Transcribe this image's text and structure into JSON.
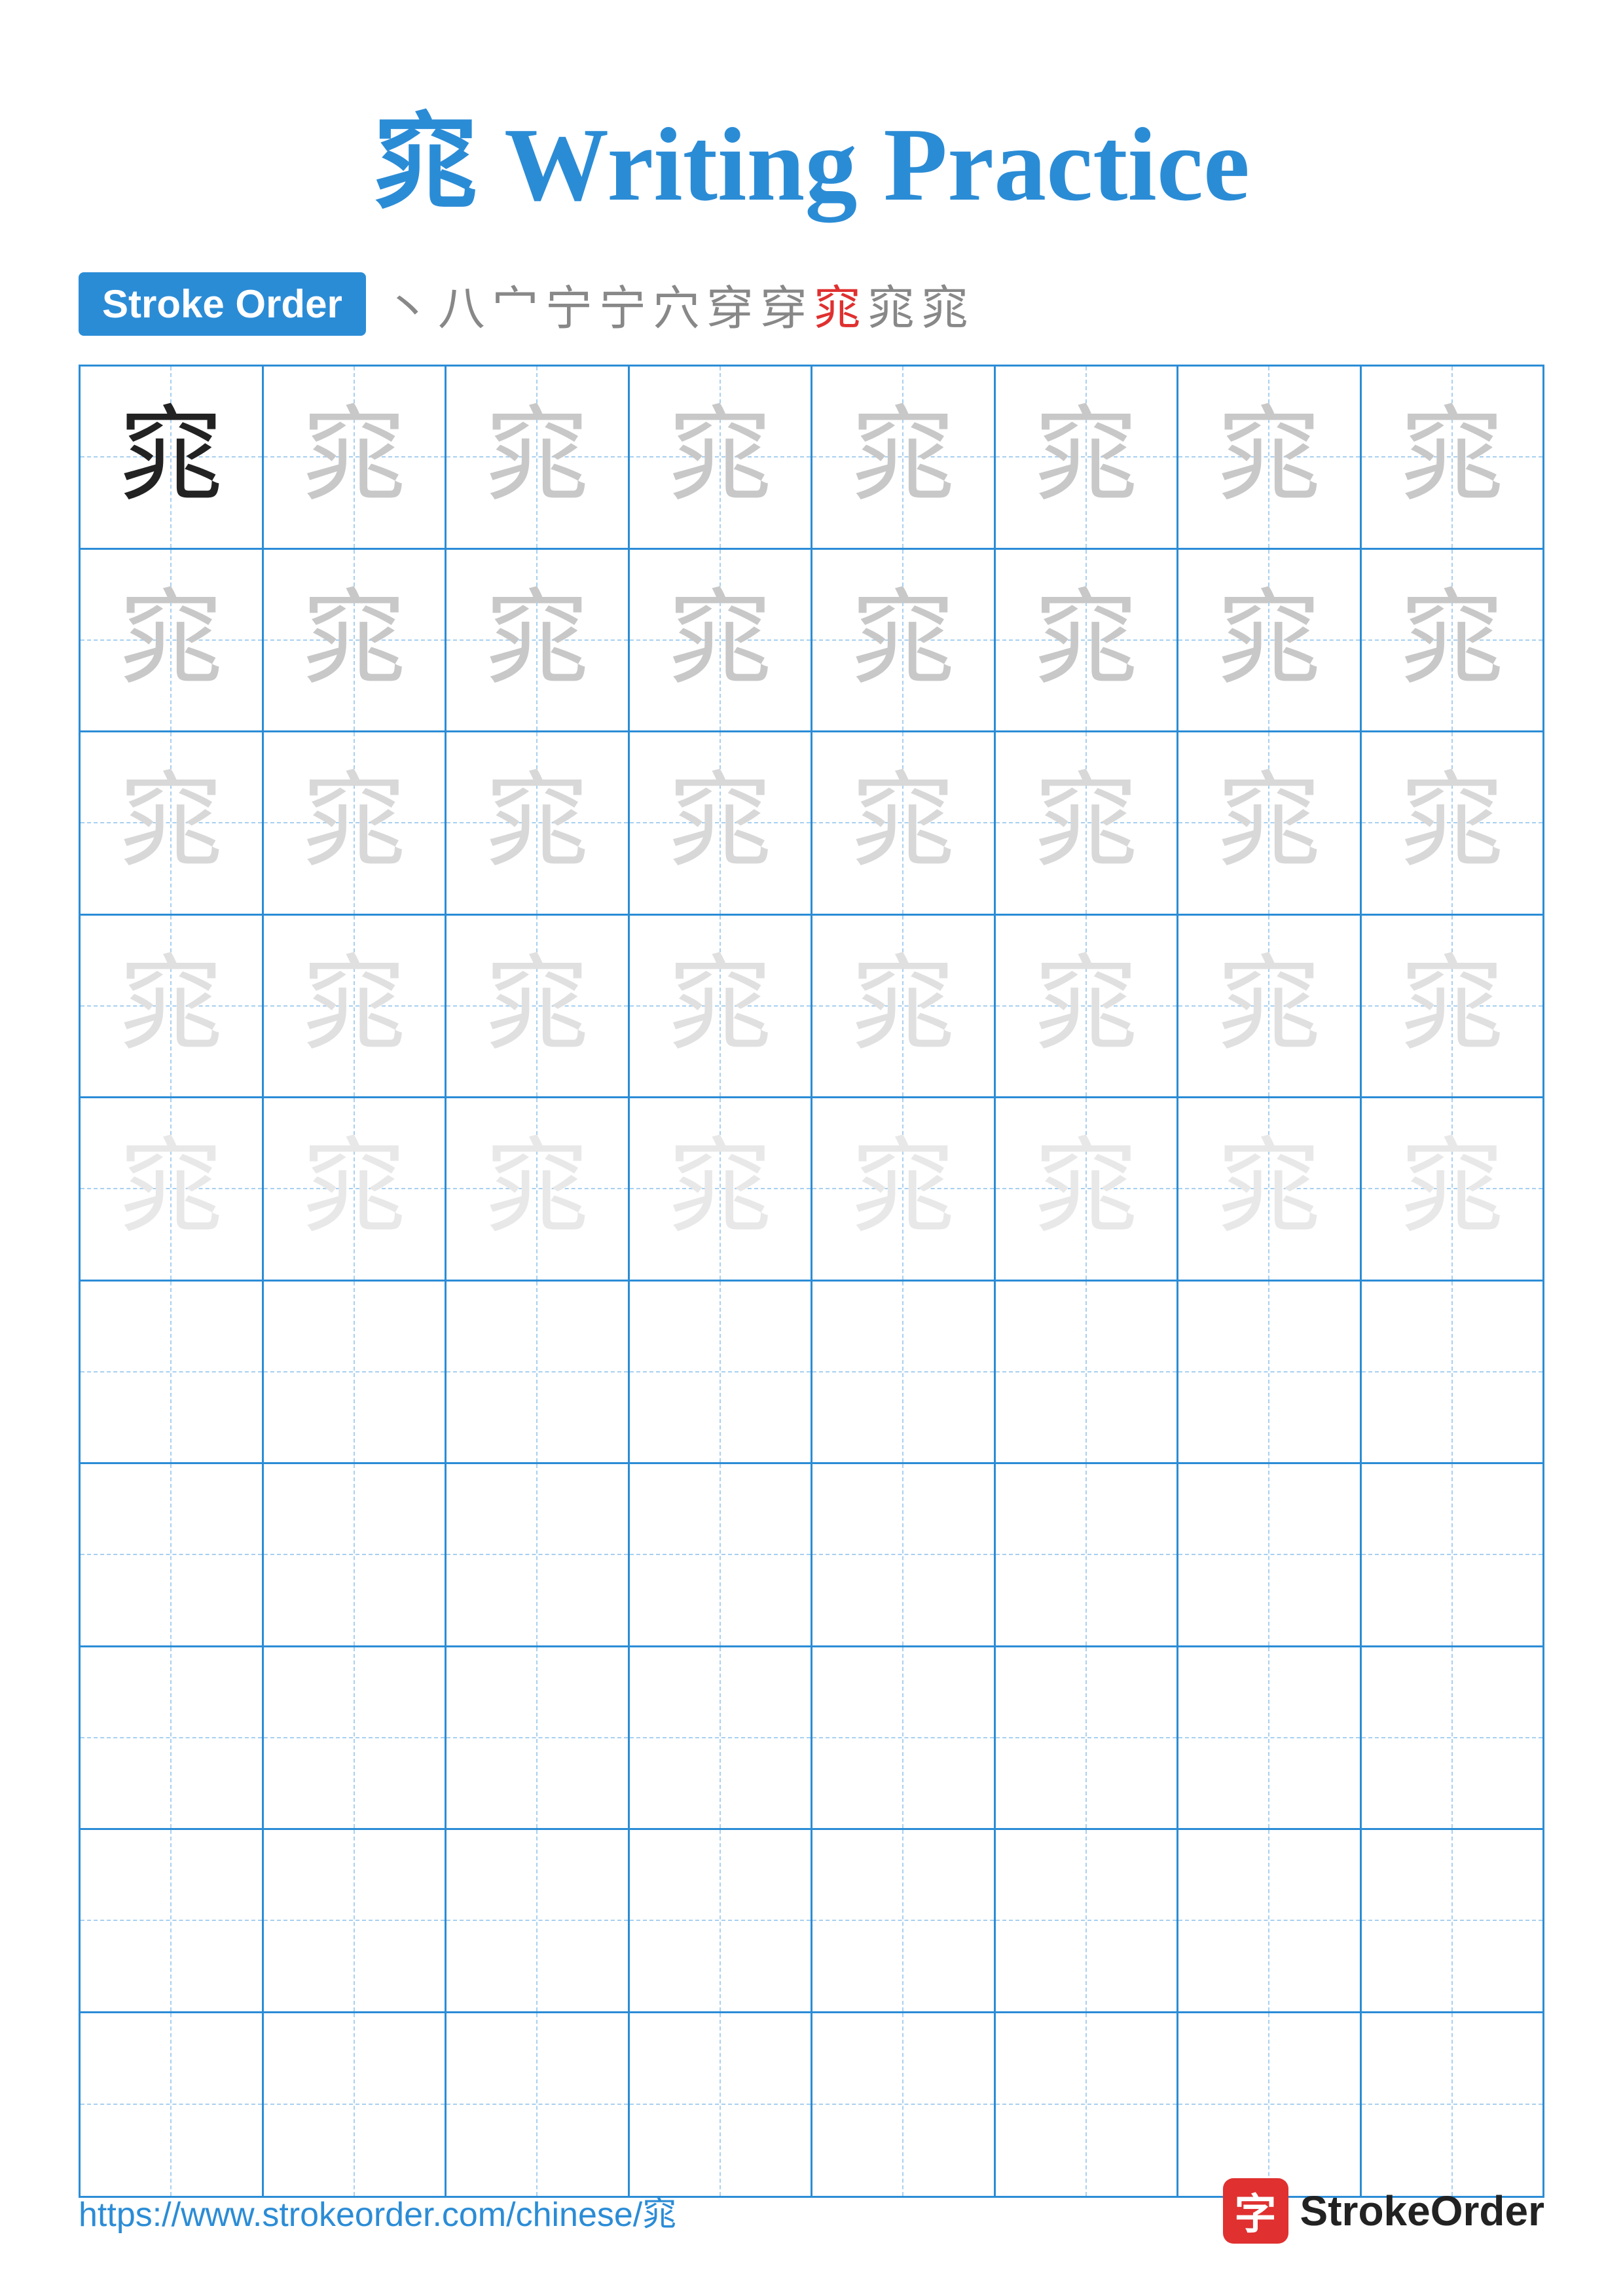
{
  "title": {
    "character": "窕",
    "label": "Writing Practice",
    "color": "#2b8cd6"
  },
  "stroke_order": {
    "badge_label": "Stroke Order",
    "strokes": [
      {
        "char": "丶",
        "style": "gray"
      },
      {
        "char": "八",
        "style": "gray"
      },
      {
        "char": "宀",
        "style": "gray"
      },
      {
        "char": "宁",
        "style": "gray"
      },
      {
        "char": "宁",
        "style": "gray"
      },
      {
        "char": "穴",
        "style": "gray"
      },
      {
        "char": "穿",
        "style": "gray"
      },
      {
        "char": "穿",
        "style": "gray"
      },
      {
        "char": "窕",
        "style": "red"
      },
      {
        "char": "窕",
        "style": "gray"
      },
      {
        "char": "窕",
        "style": "gray"
      }
    ]
  },
  "grid": {
    "rows": 10,
    "cols": 8,
    "character": "窕",
    "practice_rows": [
      [
        {
          "char": "窕",
          "style": "dark"
        },
        {
          "char": "窕",
          "style": "light1"
        },
        {
          "char": "窕",
          "style": "light1"
        },
        {
          "char": "窕",
          "style": "light1"
        },
        {
          "char": "窕",
          "style": "light1"
        },
        {
          "char": "窕",
          "style": "light1"
        },
        {
          "char": "窕",
          "style": "light1"
        },
        {
          "char": "窕",
          "style": "light1"
        }
      ],
      [
        {
          "char": "窕",
          "style": "light1"
        },
        {
          "char": "窕",
          "style": "light1"
        },
        {
          "char": "窕",
          "style": "light1"
        },
        {
          "char": "窕",
          "style": "light1"
        },
        {
          "char": "窕",
          "style": "light1"
        },
        {
          "char": "窕",
          "style": "light1"
        },
        {
          "char": "窕",
          "style": "light1"
        },
        {
          "char": "窕",
          "style": "light1"
        }
      ],
      [
        {
          "char": "窕",
          "style": "light2"
        },
        {
          "char": "窕",
          "style": "light2"
        },
        {
          "char": "窕",
          "style": "light2"
        },
        {
          "char": "窕",
          "style": "light2"
        },
        {
          "char": "窕",
          "style": "light2"
        },
        {
          "char": "窕",
          "style": "light2"
        },
        {
          "char": "窕",
          "style": "light2"
        },
        {
          "char": "窕",
          "style": "light2"
        }
      ],
      [
        {
          "char": "窕",
          "style": "light3"
        },
        {
          "char": "窕",
          "style": "light3"
        },
        {
          "char": "窕",
          "style": "light3"
        },
        {
          "char": "窕",
          "style": "light3"
        },
        {
          "char": "窕",
          "style": "light3"
        },
        {
          "char": "窕",
          "style": "light3"
        },
        {
          "char": "窕",
          "style": "light3"
        },
        {
          "char": "窕",
          "style": "light3"
        }
      ],
      [
        {
          "char": "窕",
          "style": "light4"
        },
        {
          "char": "窕",
          "style": "light4"
        },
        {
          "char": "窕",
          "style": "light4"
        },
        {
          "char": "窕",
          "style": "light4"
        },
        {
          "char": "窕",
          "style": "light4"
        },
        {
          "char": "窕",
          "style": "light4"
        },
        {
          "char": "窕",
          "style": "light4"
        },
        {
          "char": "窕",
          "style": "light4"
        }
      ],
      [
        {
          "char": "",
          "style": "empty"
        },
        {
          "char": "",
          "style": "empty"
        },
        {
          "char": "",
          "style": "empty"
        },
        {
          "char": "",
          "style": "empty"
        },
        {
          "char": "",
          "style": "empty"
        },
        {
          "char": "",
          "style": "empty"
        },
        {
          "char": "",
          "style": "empty"
        },
        {
          "char": "",
          "style": "empty"
        }
      ],
      [
        {
          "char": "",
          "style": "empty"
        },
        {
          "char": "",
          "style": "empty"
        },
        {
          "char": "",
          "style": "empty"
        },
        {
          "char": "",
          "style": "empty"
        },
        {
          "char": "",
          "style": "empty"
        },
        {
          "char": "",
          "style": "empty"
        },
        {
          "char": "",
          "style": "empty"
        },
        {
          "char": "",
          "style": "empty"
        }
      ],
      [
        {
          "char": "",
          "style": "empty"
        },
        {
          "char": "",
          "style": "empty"
        },
        {
          "char": "",
          "style": "empty"
        },
        {
          "char": "",
          "style": "empty"
        },
        {
          "char": "",
          "style": "empty"
        },
        {
          "char": "",
          "style": "empty"
        },
        {
          "char": "",
          "style": "empty"
        },
        {
          "char": "",
          "style": "empty"
        }
      ],
      [
        {
          "char": "",
          "style": "empty"
        },
        {
          "char": "",
          "style": "empty"
        },
        {
          "char": "",
          "style": "empty"
        },
        {
          "char": "",
          "style": "empty"
        },
        {
          "char": "",
          "style": "empty"
        },
        {
          "char": "",
          "style": "empty"
        },
        {
          "char": "",
          "style": "empty"
        },
        {
          "char": "",
          "style": "empty"
        }
      ],
      [
        {
          "char": "",
          "style": "empty"
        },
        {
          "char": "",
          "style": "empty"
        },
        {
          "char": "",
          "style": "empty"
        },
        {
          "char": "",
          "style": "empty"
        },
        {
          "char": "",
          "style": "empty"
        },
        {
          "char": "",
          "style": "empty"
        },
        {
          "char": "",
          "style": "empty"
        },
        {
          "char": "",
          "style": "empty"
        }
      ]
    ]
  },
  "footer": {
    "url": "https://www.strokeorder.com/chinese/窕",
    "logo_char": "字",
    "logo_text": "StrokeOrder"
  }
}
